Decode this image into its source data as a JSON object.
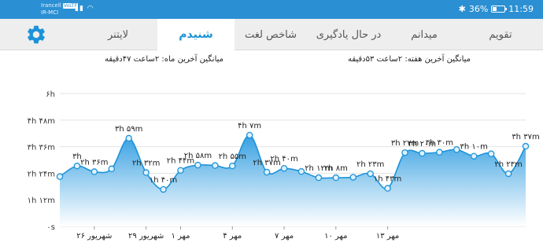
{
  "status": {
    "carrier1": "Irancell",
    "net_badge": "VoLTE",
    "carrier2": "IR-MCI",
    "battery_percent": "36%",
    "battery_level": 0.36,
    "time": "11:59"
  },
  "tabs": [
    {
      "label": "تقویم",
      "active": false
    },
    {
      "label": "میدانم",
      "active": false
    },
    {
      "label": "در حال یادگیری",
      "active": false
    },
    {
      "label": "شاخص لغت",
      "active": false
    },
    {
      "label": "شنیدم",
      "active": true
    },
    {
      "label": "لایتنر",
      "active": false
    }
  ],
  "settings_icon": "gear-icon",
  "summary": {
    "week": "میانگین آخرین هفته: ۲ساعت ۵۳دقیقه",
    "month": "میانگین آخرین ماه: ۲ساعت ۴۷دقیقه"
  },
  "colors": {
    "accent": "#1c93d9",
    "statusbar": "#2b8fd3",
    "fill_top": "#2b9be0",
    "fill_bottom": "#ffffff"
  },
  "chart_data": {
    "type": "area",
    "y_unit": "hours",
    "ylim": [
      0,
      6
    ],
    "y_ticks": [
      0,
      1.2,
      2.4,
      3.6,
      4.8,
      6
    ],
    "y_tick_labels": [
      "۰s",
      "۱h ۱۲m",
      "۲h ۲۴m",
      "۳h ۳۶m",
      "۴h ۴۸m",
      "۶h"
    ],
    "x_tick_labels": [
      {
        "index": 2,
        "label": "۲۶ شهریور"
      },
      {
        "index": 5,
        "label": "۲۹ شهریور"
      },
      {
        "index": 7,
        "label": "۱ مهر"
      },
      {
        "index": 10,
        "label": "۴ مهر"
      },
      {
        "index": 13,
        "label": "۷ مهر"
      },
      {
        "index": 16,
        "label": "۱۰ مهر"
      },
      {
        "index": 19,
        "label": "۱۳ مهر"
      }
    ],
    "values": [
      2.25,
      2.73,
      2.47,
      2.6,
      3.98,
      2.43,
      1.67,
      2.53,
      2.77,
      2.75,
      2.73,
      4.12,
      2.45,
      2.62,
      2.48,
      2.2,
      2.2,
      2.22,
      2.38,
      1.72,
      3.33,
      3.3,
      3.35,
      3.47,
      3.17,
      3.28,
      2.38,
      3.62
    ],
    "data_labels": [
      "",
      "۳h",
      "۲h ۳۶m",
      "",
      "۳h ۵۹m",
      "۲h ۳۲m",
      "۱h ۴۰m",
      "۲h ۴۴m",
      "۲h ۵۸m",
      "",
      "۲h ۵۵m",
      "۴h ۷m",
      "۲h ۳۷m",
      "۲h ۴۰m",
      "",
      "۲h ۱۲m",
      "۲h ۸m",
      "",
      "۲h ۲۳m",
      "۱h ۴۳m",
      "۳h ۲۷m",
      "۳h ۲۰m",
      "۳h ۳۰m",
      "",
      "۳h ۱۰m",
      "",
      "۲h ۲۳m",
      "۳h ۳۷m"
    ]
  }
}
